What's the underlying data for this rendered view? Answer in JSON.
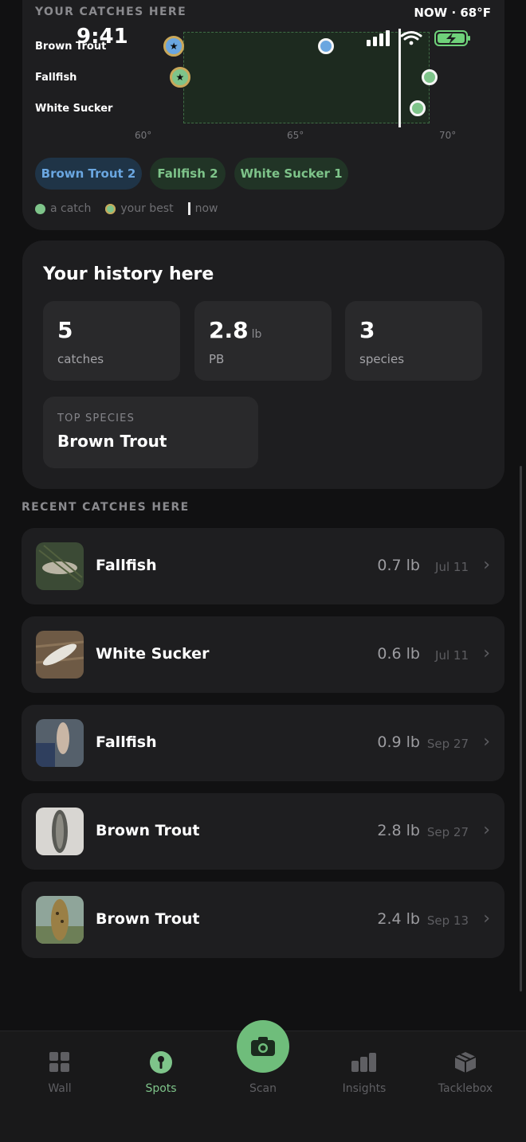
{
  "status_bar": {
    "time": "9:41",
    "icons": [
      "signal-icon",
      "wifi-icon",
      "battery-charging-icon"
    ]
  },
  "catches_card": {
    "section_label": "YOUR CATCHES HERE",
    "now_weather": "NOW · 68°F",
    "species_rows": [
      {
        "label": "Brown Trout",
        "color": "#6aa6e0"
      },
      {
        "label": "Fallfish",
        "color": "#7ec48a"
      },
      {
        "label": "White Sucker",
        "color": "#7ec48a"
      }
    ],
    "chart_data": {
      "type": "scatter",
      "xlabel": "",
      "ylabel": "",
      "x_ticks": [
        "60°",
        "65°",
        "70°"
      ],
      "xlim": [
        57,
        72
      ],
      "categories": [
        "Brown Trout",
        "Fallfish",
        "White Sucker"
      ],
      "now_x": 68.4,
      "preferred_range": [
        61.3,
        69.4
      ],
      "series": [
        {
          "name": "a catch",
          "points": [
            {
              "species": "Brown Trout",
              "x": 66.0
            },
            {
              "species": "Fallfish",
              "x": 69.4
            },
            {
              "species": "White Sucker",
              "x": 69.0
            }
          ]
        },
        {
          "name": "your best",
          "points": [
            {
              "species": "Brown Trout",
              "x": 61.0
            },
            {
              "species": "Fallfish",
              "x": 61.2
            }
          ]
        }
      ]
    },
    "pills": [
      {
        "label": "Brown Trout 2",
        "color": "#6aa6e0",
        "bg": "#1f3447"
      },
      {
        "label": "Fallfish 2",
        "color": "#7ec48a",
        "bg": "#213426"
      },
      {
        "label": "White Sucker 1",
        "color": "#7ec48a",
        "bg": "#213426"
      }
    ],
    "legend": {
      "catch": "a catch",
      "best": "your best",
      "now": "now"
    }
  },
  "history_card": {
    "title": "Your history here",
    "stats": [
      {
        "value": "5",
        "unit": "",
        "caption": "catches"
      },
      {
        "value": "2.8",
        "unit": "lb",
        "caption": "PB"
      },
      {
        "value": "3",
        "unit": "",
        "caption": "species"
      }
    ],
    "top_species": {
      "caption": "TOP SPECIES",
      "value": "Brown Trout"
    }
  },
  "recent": {
    "section_label": "RECENT CATCHES HERE",
    "items": [
      {
        "name": "Fallfish",
        "weight": "0.7 lb",
        "date": "Jul 11"
      },
      {
        "name": "White Sucker",
        "weight": "0.6 lb",
        "date": "Jul 11"
      },
      {
        "name": "Fallfish",
        "weight": "0.9 lb",
        "date": "Sep 27"
      },
      {
        "name": "Brown Trout",
        "weight": "2.8 lb",
        "date": "Sep 27"
      },
      {
        "name": "Brown Trout",
        "weight": "2.4 lb",
        "date": "Sep 13"
      }
    ]
  },
  "nav": {
    "wall": "Wall",
    "spots": "Spots",
    "scan": "Scan",
    "insights": "Insights",
    "tacklebox": "Tacklebox",
    "active": "Spots"
  },
  "colors": {
    "accent_green": "#6fbd7b",
    "accent_blue": "#6aa6e0",
    "best_gold": "#c9a85a"
  }
}
